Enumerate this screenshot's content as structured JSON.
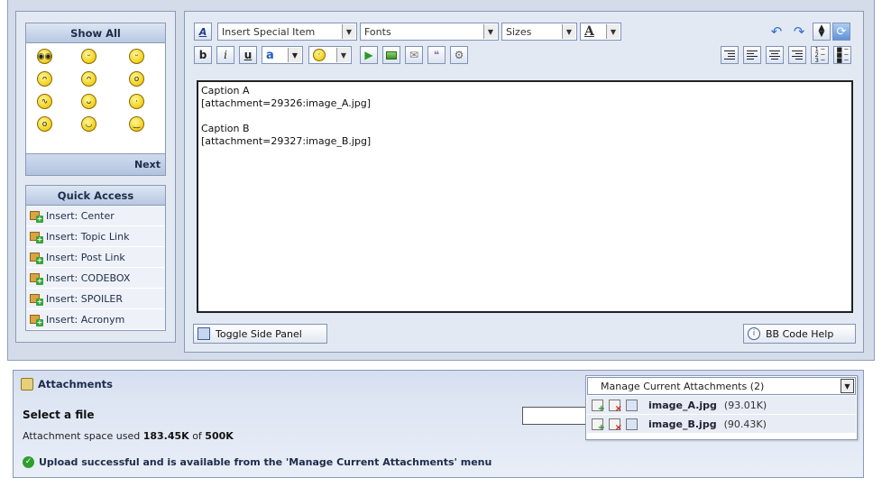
{
  "side_panel": {
    "smilies_title": "Show All",
    "smilies_next": "Next",
    "smilies": [
      "cool",
      "smile",
      "grin",
      "angry",
      "mad",
      "shocked",
      "confused",
      "evil",
      "eek",
      "surprised",
      "happy",
      "neutral"
    ],
    "quick_access": {
      "title": "Quick Access",
      "items": [
        "Insert: Center",
        "Insert: Topic Link",
        "Insert: Post Link",
        "Insert: CODEBOX",
        "Insert: SPOILER",
        "Insert: Acronym"
      ]
    }
  },
  "toolbar": {
    "special_item_select": "Insert Special Item",
    "fonts_select": "Fonts",
    "sizes_select": "Sizes",
    "color_select": "A",
    "bold": "b",
    "italic": "i",
    "underline": "u",
    "text_color": "a",
    "icons": [
      "spellcheck-icon",
      "undo-icon",
      "redo-icon",
      "resize-icon",
      "refresh-icon",
      "insert-link-icon",
      "insert-image-icon",
      "insert-email-icon",
      "insert-quote-icon",
      "insert-code-icon",
      "indent-icon",
      "align-left-icon",
      "align-center-icon",
      "align-right-icon",
      "ordered-list-icon",
      "unordered-list-icon"
    ]
  },
  "editor": {
    "content": "Caption A\n[attachment=29326:image_A.jpg]\n\nCaption B\n[attachment=29327:image_B.jpg]",
    "toggle_panel": "Toggle Side Panel",
    "help": "BB Code Help"
  },
  "attachments": {
    "title": "Attachments",
    "select_file": "Select a file",
    "space_prefix": "Attachment space used",
    "space_used": "183.45K",
    "space_of": "of",
    "space_total": "500K",
    "upload_message": "Upload successful and is available from the 'Manage Current Attachments' menu",
    "manage_label": "Manage Current Attachments (2)",
    "files": [
      {
        "name": "image_A.jpg",
        "size": "(93.01K)"
      },
      {
        "name": "image_B.jpg",
        "size": "(90.43K)"
      }
    ]
  }
}
